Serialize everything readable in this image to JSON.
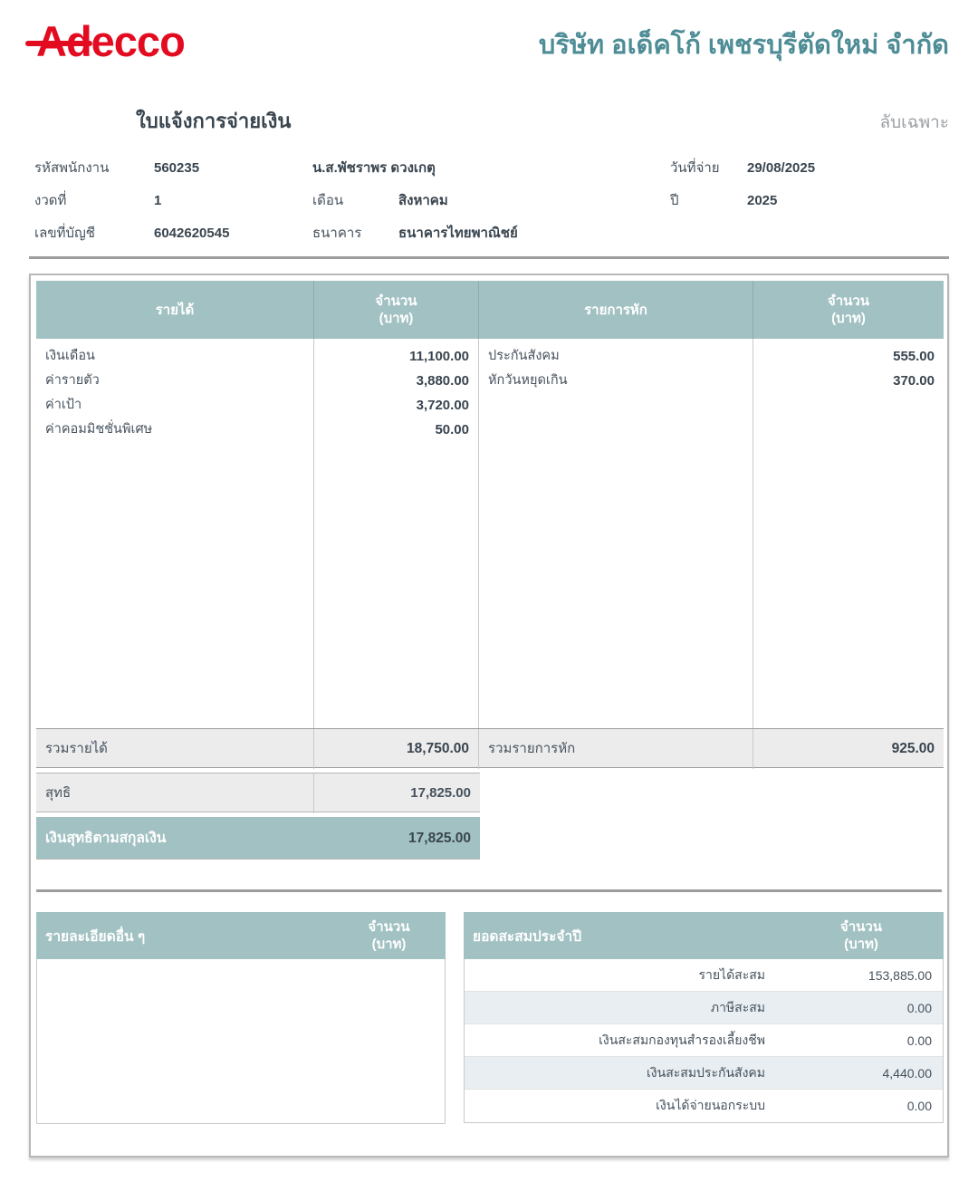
{
  "brand": {
    "logo_text": "Adecco",
    "company_name": "บริษัท อเด็คโก้ เพชรบุรีตัดใหม่ จำกัด"
  },
  "header": {
    "title": "ใบแจ้งการจ่ายเงิน",
    "confidential": "ลับเฉพาะ"
  },
  "labels": {
    "amount": "จำนวน",
    "baht": "(บาท)"
  },
  "info": {
    "employee_id_label": "รหัสพนักงาน",
    "employee_id": "560235",
    "employee_name": "น.ส.พัชราพร ดวงเกตุ",
    "pay_date_label": "วันที่จ่าย",
    "pay_date": "29/08/2025",
    "period_label": "งวดที่",
    "period": "1",
    "month_label": "เดือน",
    "month": "สิงหาคม",
    "year_label": "ปี",
    "year": "2025",
    "account_label": "เลขที่บัญชี",
    "account": "6042620545",
    "bank_label": "ธนาคาร",
    "bank": "ธนาคารไทยพาณิชย์"
  },
  "main_table": {
    "income_header": "รายได้",
    "deduction_header": "รายการหัก",
    "income_items": [
      {
        "label": "เงินเดือน",
        "amount": "11,100.00"
      },
      {
        "label": "ค่ารายตัว",
        "amount": "3,880.00"
      },
      {
        "label": "ค่าเป้า",
        "amount": "3,720.00"
      },
      {
        "label": "ค่าคอมมิชชั่นพิเศษ",
        "amount": "50.00"
      }
    ],
    "deduction_items": [
      {
        "label": "ประกันสังคม",
        "amount": "555.00"
      },
      {
        "label": "หักวันหยุดเกิน",
        "amount": "370.00"
      }
    ],
    "totals": {
      "income_total_label": "รวมรายได้",
      "income_total": "18,750.00",
      "deduction_total_label": "รวมรายการหัก",
      "deduction_total": "925.00",
      "net_label": "สุทธิ",
      "net": "17,825.00",
      "net_currency_label": "เงินสุทธิตามสกุลเงิน",
      "net_currency": "17,825.00"
    }
  },
  "other_details": {
    "title": "รายละเอียดอื่น ๆ"
  },
  "ytd": {
    "title": "ยอดสะสมประจำปี",
    "rows": [
      {
        "label": "รายได้สะสม",
        "amount": "153,885.00"
      },
      {
        "label": "ภาษีสะสม",
        "amount": "0.00"
      },
      {
        "label": "เงินสะสมกองทุนสำรองเลี้ยงชีพ",
        "amount": "0.00"
      },
      {
        "label": "เงินสะสมประกันสังคม",
        "amount": "4,440.00"
      },
      {
        "label": "เงินได้จ่ายนอกระบบ",
        "amount": "0.00"
      }
    ]
  },
  "colors": {
    "brand_red": "#e30b20",
    "company_teal": "#4e8d96",
    "table_header_teal": "#a2c1c2",
    "summary_gray": "#ececec",
    "alt_row_blue": "#e8eef1",
    "text_dark": "#39454f"
  }
}
